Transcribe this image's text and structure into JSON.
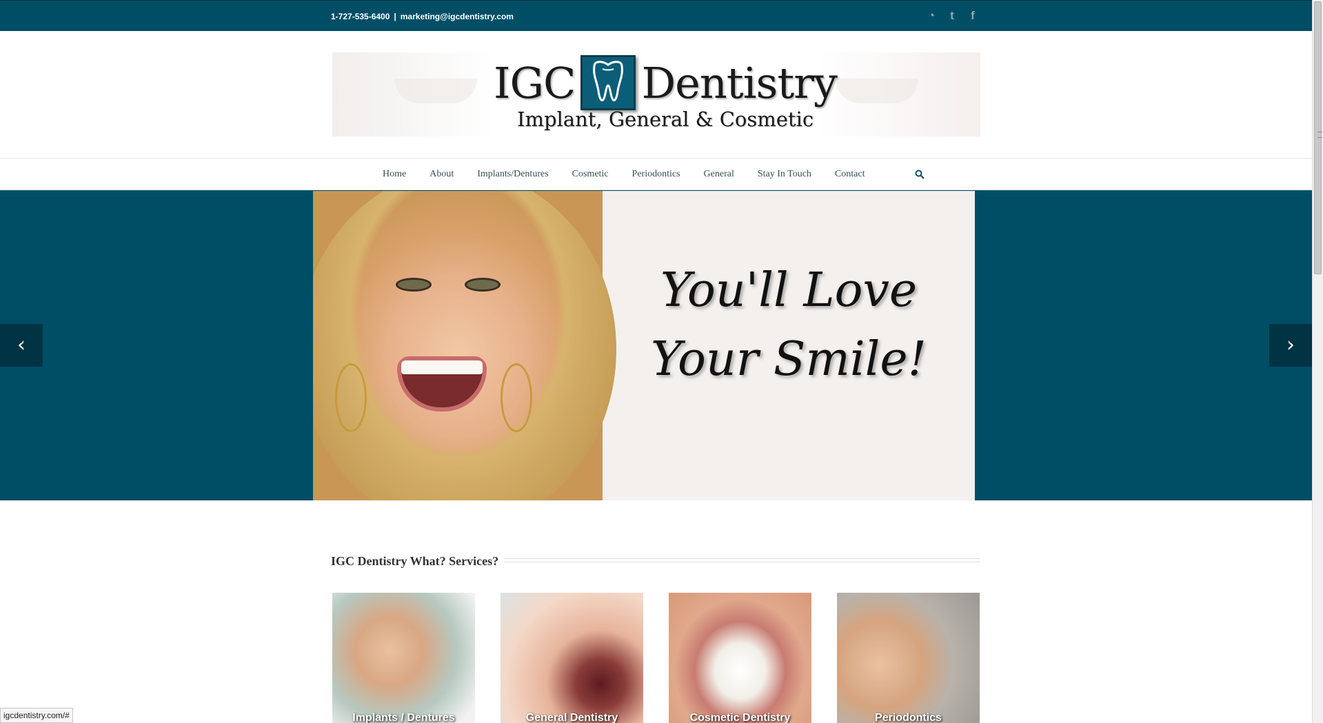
{
  "topbar": {
    "phone": "1-727-535-6400",
    "separator": "|",
    "email": "marketing@igcdentistry.com",
    "social": [
      {
        "icon": "rss-icon",
        "glyph": "◔"
      },
      {
        "icon": "twitter-icon",
        "glyph": "t"
      },
      {
        "icon": "facebook-icon",
        "glyph": "f"
      }
    ]
  },
  "logo": {
    "line1_left": "IGC",
    "line1_right": "Dentistry",
    "line2": "Implant, General & Cosmetic"
  },
  "nav": {
    "items": [
      "Home",
      "About",
      "Implants/Dentures",
      "Cosmetic",
      "Periodontics",
      "General",
      "Stay In Touch",
      "Contact"
    ]
  },
  "slider": {
    "slogan_line1": "You'll Love",
    "slogan_line2": "Your Smile!",
    "prev_glyph": "‹",
    "next_glyph": "›"
  },
  "services": {
    "title": "IGC Dentistry What? Services?",
    "cards": [
      {
        "caption": "Implants / Dentures"
      },
      {
        "caption": "General Dentistry"
      },
      {
        "caption": "Cosmetic Dentistry"
      },
      {
        "caption": "Periodontics"
      }
    ]
  },
  "status": {
    "url": "igcdentistry.com/#"
  },
  "colors": {
    "brand": "#004e66",
    "nav_text": "#3a4d56"
  }
}
